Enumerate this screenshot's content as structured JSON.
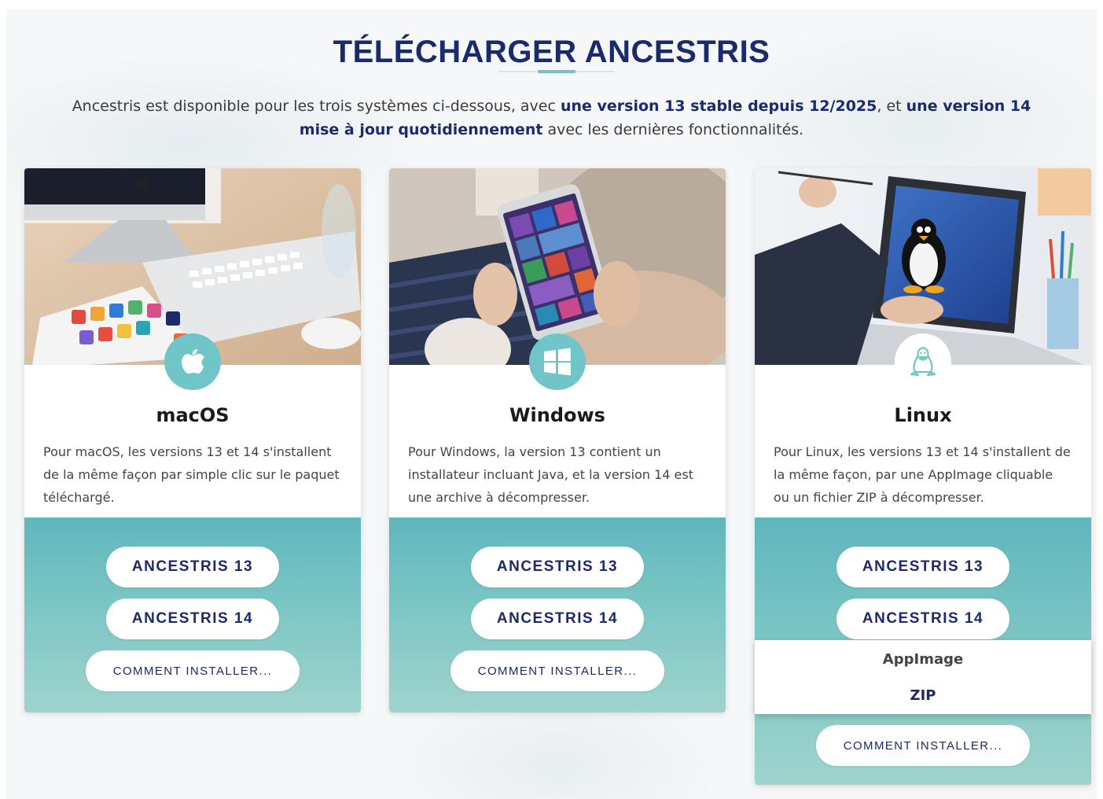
{
  "heading": "TÉLÉCHARGER ANCESTRIS",
  "intro": {
    "t1": "Ancestris est disponible pour les trois systèmes ci-dessous, avec ",
    "b1": "une version 13 stable depuis 12/2025",
    "t2": ", et ",
    "b2": "une version 14 mise à jour quotidiennement",
    "t3": " avec les dernières fonctionnalités."
  },
  "cards": [
    {
      "title": "macOS",
      "icon": "apple-icon",
      "desc": "Pour macOS, les versions 13 et 14 s'installent de la même façon par simple clic sur le paquet téléchargé.",
      "btn13": "ANCESTRIS 13",
      "btn14": "ANCESTRIS 14",
      "how": "COMMENT INSTALLER..."
    },
    {
      "title": "Windows",
      "icon": "windows-icon",
      "desc": "Pour Windows, la version 13 contient un installateur incluant Java, et la version 14 est une archive à décompresser.",
      "btn13": "ANCESTRIS 13",
      "btn14": "ANCESTRIS 14",
      "how": "COMMENT INSTALLER..."
    },
    {
      "title": "Linux",
      "icon": "tux-icon",
      "desc": "Pour Linux, les versions 13 et 14 s'installent de la même façon, par une AppImage cliquable ou un fichier ZIP à décompresser.",
      "btn13": "ANCESTRIS 13",
      "btn14": "ANCESTRIS 14",
      "dropdown": [
        "AppImage",
        "ZIP"
      ],
      "how": "COMMENT INSTALLER..."
    }
  ],
  "colors": {
    "navy": "#1b2a6b",
    "teal": "#6fc5c7",
    "card_footer_top": "#5fb6bd",
    "card_footer_bottom": "#9fd3cd"
  }
}
